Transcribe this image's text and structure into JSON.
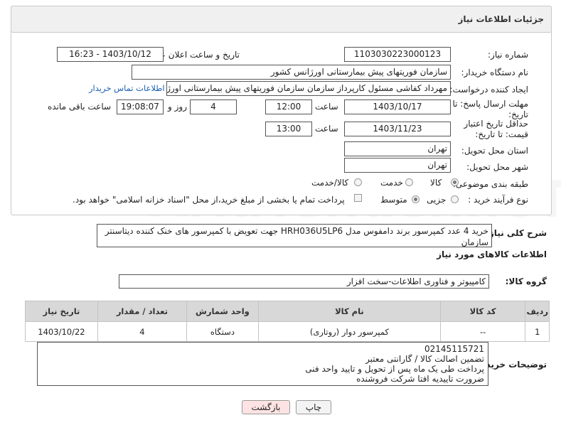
{
  "header": {
    "title": "جزئیات اطلاعات نیاز"
  },
  "fields": {
    "need_number": {
      "label": "شماره نیاز:",
      "value": "1103030223000123"
    },
    "announce_datetime": {
      "label": "تاریخ و ساعت اعلان عمومی:",
      "value": "1403/10/12 - 16:23"
    },
    "buyer_org": {
      "label": "نام دستگاه خریدار:",
      "value": "سازمان فوریتهای پیش بیمارستانی اورژانس کشور"
    },
    "requester": {
      "label": "ایجاد کننده درخواست:",
      "value": "مهرداد کفاشی مسئول کارپرداز سازمان سازمان فوریتهای پیش بیمارستانی اورژا"
    },
    "buyer_contact_link": "اطلاعات تماس خریدار",
    "deadline": {
      "label": "مهلت ارسال پاسخ: تا تاریخ:",
      "date": "1403/10/17",
      "time_label": "ساعت",
      "time": "12:00",
      "days": "4",
      "days_label": "روز و",
      "remaining": "19:08:07",
      "remaining_label": "ساعت باقی مانده"
    },
    "validity": {
      "label": "حداقل تاریخ اعتبار قیمت: تا تاریخ:",
      "date": "1403/11/23",
      "time_label": "ساعت",
      "time": "13:00"
    },
    "province": {
      "label": "استان محل تحویل:",
      "value": "تهران"
    },
    "city": {
      "label": "شهر محل تحویل:",
      "value": "تهران"
    },
    "category": {
      "label": "طبقه بندی موضوعی:",
      "options": [
        "کالا",
        "خدمت",
        "کالا/خدمت"
      ],
      "selected": "کالا"
    },
    "purchase_type": {
      "label": "نوع فرآیند خرید :",
      "options": [
        "جزیی",
        "متوسط"
      ],
      "selected": "متوسط",
      "note": "پرداخت تمام یا بخشی از مبلغ خرید،از محل \"اسناد خزانه اسلامی\" خواهد بود."
    }
  },
  "description": {
    "label": "شرح کلی نیاز:",
    "value": "خرید 4 عدد کمپرسور برند دامفوس مدل HRH036U5LP6 جهت تعویض با کمپرسور های خنک کننده دیتاسنتر سازمان"
  },
  "goods_section_title": "اطلاعات کالاهای مورد نیاز",
  "goods_group": {
    "label": "گروه کالا:",
    "value": "کامپیوتر و فناوری اطلاعات-سخت افزار"
  },
  "table": {
    "headers": [
      "ردیف",
      "کد کالا",
      "نام کالا",
      "واحد شمارش",
      "تعداد / مقدار",
      "تاریخ نیاز"
    ],
    "rows": [
      [
        "1",
        "--",
        "کمپرسور دوار (روتاری)",
        "دستگاه",
        "4",
        "1403/10/22"
      ]
    ]
  },
  "buyer_notes": {
    "label": "توضیحات خریدار:",
    "lines": [
      "02145115721",
      "تضمین اصالت کالا / گارانتی معتبر",
      "پرداخت طی یک ماه  پس از تحویل و  تایید واحد فنی",
      "ضرورت تاییدیه افتا شرکت فروشنده"
    ]
  },
  "buttons": {
    "print": "چاپ",
    "back": "بازگشت"
  },
  "watermark": "AriaTender.neT"
}
